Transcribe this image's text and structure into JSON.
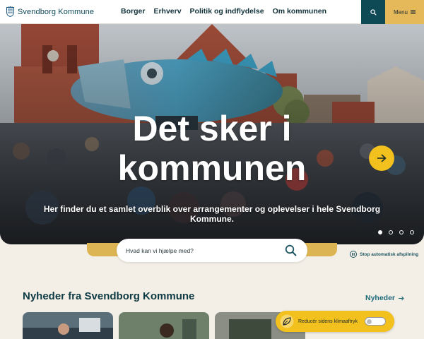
{
  "header": {
    "logo_text": "Svendborg Kommune",
    "nav": [
      "Borger",
      "Erhverv",
      "Politik og indflydelse",
      "Om kommunen"
    ],
    "search_icon": "search-icon",
    "menu_label": "Menu",
    "menu_icon": "hamburger-icon"
  },
  "hero": {
    "title_line1": "Det sker i",
    "title_line2": "kommunen",
    "subtitle": "Her finder du et samlet overblik over arrangementer og oplevelser i hele Svendborg Kommune.",
    "next_icon": "arrow-right-icon",
    "slides": 4,
    "active_slide": 1
  },
  "search": {
    "placeholder": "Hvad kan vi hjælpe med?",
    "icon": "search-icon"
  },
  "autoplay": {
    "label": "Stop automatisk afspilning",
    "icon": "pause-icon"
  },
  "news": {
    "title": "Nyheder fra Svendborg Kommune",
    "link_label": "Nyheder",
    "link_icon": "arrow-right-icon"
  },
  "climate": {
    "label": "Reducér sidens klimaaftryk",
    "icon": "leaf-icon",
    "enabled": false
  },
  "colors": {
    "primary": "#0e4a55",
    "accent": "#e5b85a",
    "yellow": "#f2c11d",
    "background": "#f3eee6"
  }
}
